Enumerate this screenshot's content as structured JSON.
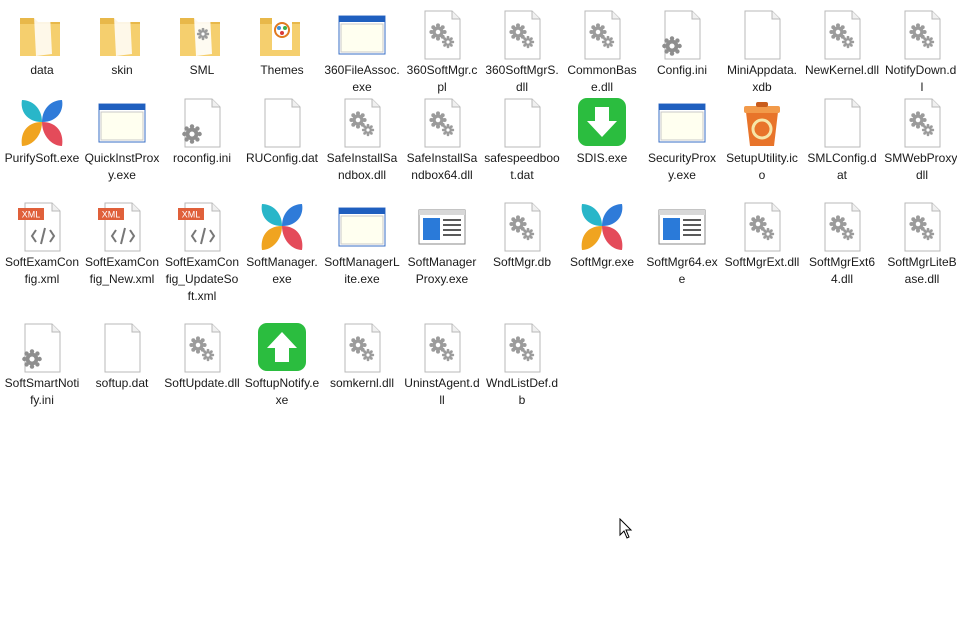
{
  "files": [
    {
      "label": "data",
      "icon": "folder-icon",
      "type": "folder"
    },
    {
      "label": "skin",
      "icon": "folder-icon",
      "type": "folder"
    },
    {
      "label": "SML",
      "icon": "folder-icon",
      "type": "folder-gear"
    },
    {
      "label": "Themes",
      "icon": "folder-icon",
      "type": "folder-theme"
    },
    {
      "label": "360FileAssoc.exe",
      "icon": "application-window-icon",
      "type": "window"
    },
    {
      "label": "360SoftMgr.cpl",
      "icon": "gear-file-icon",
      "type": "gearfile"
    },
    {
      "label": "360SoftMgrS.dll",
      "icon": "gear-file-icon",
      "type": "gearfile"
    },
    {
      "label": "CommonBase.dll",
      "icon": "gear-file-icon",
      "type": "gearfile"
    },
    {
      "label": "Config.ini",
      "icon": "settings-file-icon",
      "type": "inifile"
    },
    {
      "label": "MiniAppdata.xdb",
      "icon": "blank-file-icon",
      "type": "blank"
    },
    {
      "label": "NewKernel.dll",
      "icon": "gear-file-icon",
      "type": "gearfile"
    },
    {
      "label": "NotifyDown.dll",
      "icon": "gear-file-icon",
      "type": "gearfile"
    },
    {
      "label": "PurifySoft.exe",
      "icon": "petal-logo-icon",
      "type": "petal"
    },
    {
      "label": "QuickInstProxy.exe",
      "icon": "application-window-icon",
      "type": "window"
    },
    {
      "label": "roconfig.ini",
      "icon": "settings-file-icon",
      "type": "inifile"
    },
    {
      "label": "RUConfig.dat",
      "icon": "blank-file-icon",
      "type": "blank"
    },
    {
      "label": "SafeInstallSandbox.dll",
      "icon": "gear-file-icon",
      "type": "gearfile"
    },
    {
      "label": "SafeInstallSandbox64.dll",
      "icon": "gear-file-icon",
      "type": "gearfile"
    },
    {
      "label": "safespeedboot.dat",
      "icon": "blank-file-icon",
      "type": "blank"
    },
    {
      "label": "SDIS.exe",
      "icon": "green-download-icon",
      "type": "greendown"
    },
    {
      "label": "SecurityProxy.exe",
      "icon": "application-window-icon",
      "type": "window"
    },
    {
      "label": "SetupUtility.ico",
      "icon": "recycle-bin-icon",
      "type": "recycle"
    },
    {
      "label": "SMLConfig.dat",
      "icon": "blank-file-icon",
      "type": "blank"
    },
    {
      "label": "SMWebProxy.dll",
      "icon": "gear-file-icon",
      "type": "gearfile"
    },
    {
      "label": "SoftExamConfig.xml",
      "icon": "xml-file-icon",
      "type": "xml"
    },
    {
      "label": "SoftExamConfig_New.xml",
      "icon": "xml-file-icon",
      "type": "xml"
    },
    {
      "label": "SoftExamConfig_UpdateSoft.xml",
      "icon": "xml-file-icon",
      "type": "xml"
    },
    {
      "label": "SoftManager.exe",
      "icon": "petal-logo-icon",
      "type": "petal"
    },
    {
      "label": "SoftManagerLite.exe",
      "icon": "application-window-icon",
      "type": "window"
    },
    {
      "label": "SoftManagerProxy.exe",
      "icon": "application-window-blue-icon",
      "type": "windowblue"
    },
    {
      "label": "SoftMgr.db",
      "icon": "gear-file-icon",
      "type": "gearfile"
    },
    {
      "label": "SoftMgr.exe",
      "icon": "petal-logo-icon",
      "type": "petal"
    },
    {
      "label": "SoftMgr64.exe",
      "icon": "application-window-blue-icon",
      "type": "windowblue"
    },
    {
      "label": "SoftMgrExt.dll",
      "icon": "gear-file-icon",
      "type": "gearfile"
    },
    {
      "label": "SoftMgrExt64.dll",
      "icon": "gear-file-icon",
      "type": "gearfile"
    },
    {
      "label": "SoftMgrLiteBase.dll",
      "icon": "gear-file-icon",
      "type": "gearfile"
    },
    {
      "label": "SoftSmartNotify.ini",
      "icon": "settings-file-icon",
      "type": "inifile"
    },
    {
      "label": "softup.dat",
      "icon": "blank-file-icon",
      "type": "blank"
    },
    {
      "label": "SoftUpdate.dll",
      "icon": "gear-file-icon",
      "type": "gearfile"
    },
    {
      "label": "SoftupNotify.exe",
      "icon": "green-upload-icon",
      "type": "greenup"
    },
    {
      "label": "somkernl.dll",
      "icon": "gear-file-icon",
      "type": "gearfile"
    },
    {
      "label": "UninstAgent.dll",
      "icon": "gear-file-icon",
      "type": "gearfile"
    },
    {
      "label": "WndListDef.db",
      "icon": "gear-file-icon",
      "type": "gearfile"
    }
  ],
  "colors": {
    "folder": "#f5cf6e",
    "folder_dark": "#e8b84a",
    "green": "#2bbd3f",
    "window_title": "#1f5fbf",
    "xml_badge": "#e0603a"
  }
}
